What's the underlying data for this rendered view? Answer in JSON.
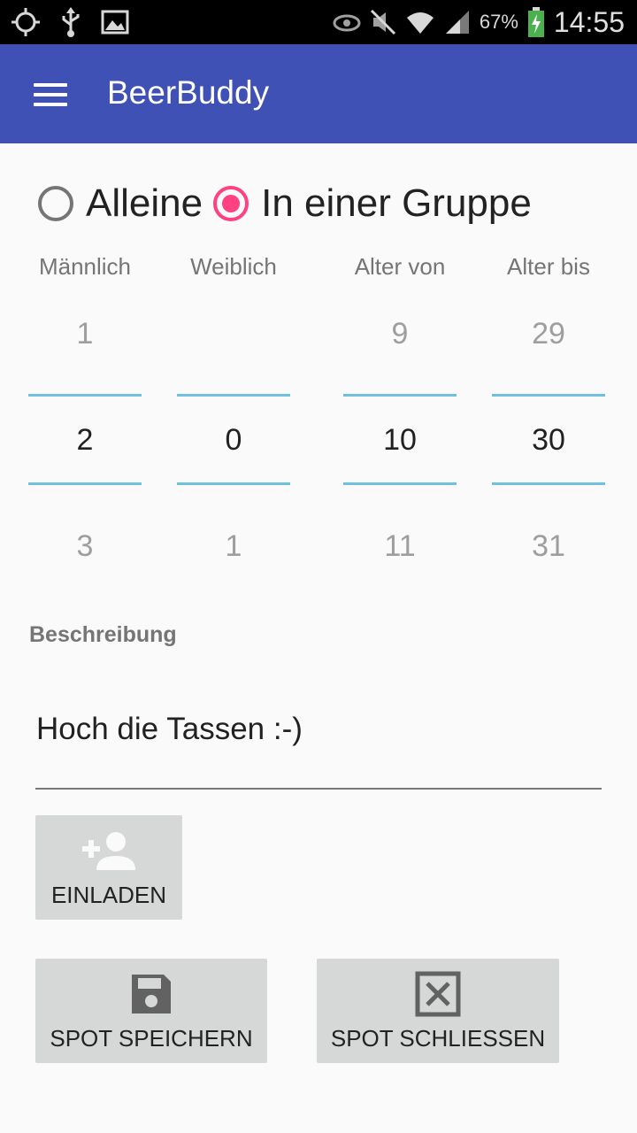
{
  "statusbar": {
    "battery_percent": "67%",
    "time": "14:55",
    "icons": [
      "location-icon",
      "usb-icon",
      "image-icon",
      "eye-icon",
      "mute-icon",
      "wifi-icon",
      "signal-icon",
      "battery-charging-icon"
    ]
  },
  "appbar": {
    "title": "BeerBuddy",
    "color": "#3f51b5"
  },
  "mode": {
    "options": [
      {
        "label": "Alleine",
        "checked": false
      },
      {
        "label": "In einer Gruppe",
        "checked": true
      }
    ],
    "accent": "#ff4081"
  },
  "pickers": [
    {
      "header": "Männlich",
      "prev": "1",
      "current": "2",
      "next": "3"
    },
    {
      "header": "Weiblich",
      "prev": "",
      "current": "0",
      "next": "1"
    },
    {
      "header": "Alter von",
      "prev": "9",
      "current": "10",
      "next": "11"
    },
    {
      "header": "Alter bis",
      "prev": "29",
      "current": "30",
      "next": "31"
    }
  ],
  "description": {
    "label": "Beschreibung",
    "value": "Hoch die Tassen :-)"
  },
  "buttons": {
    "invite": {
      "label": "EINLADEN",
      "icon": "add-person-icon"
    },
    "save": {
      "label": "SPOT SPEICHERN",
      "icon": "save-icon"
    },
    "close": {
      "label": "SPOT SCHLIESSEN",
      "icon": "close-box-icon"
    }
  }
}
